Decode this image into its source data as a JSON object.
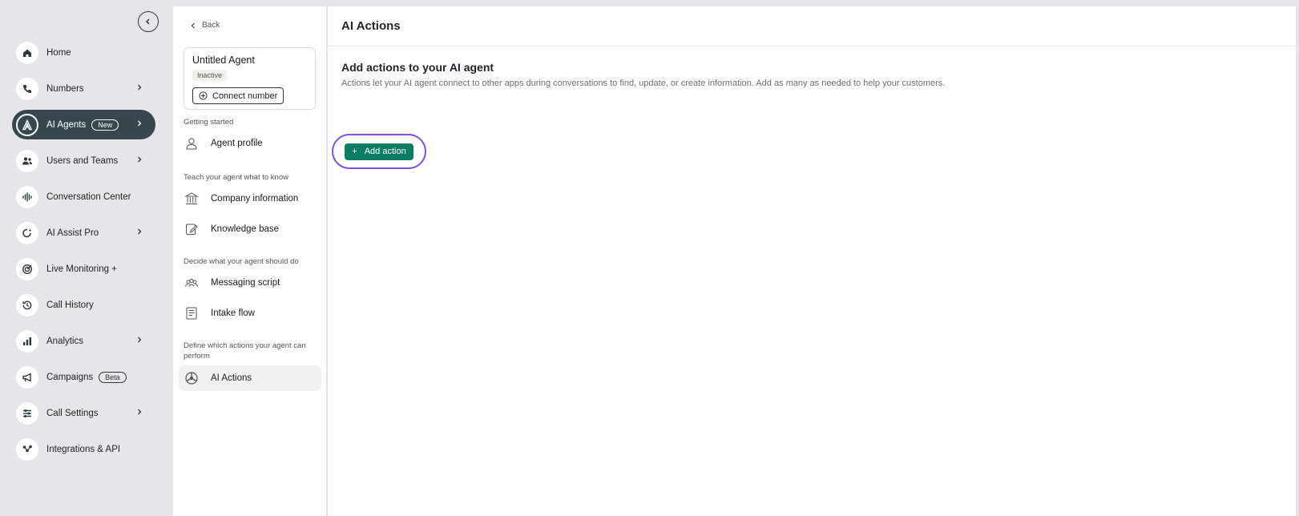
{
  "sidebar": {
    "collapse_label": "‹",
    "items": [
      {
        "label": "Home",
        "icon": "home-icon",
        "chevron": false,
        "badge": ""
      },
      {
        "label": "Numbers",
        "icon": "phone-icon",
        "chevron": true,
        "badge": ""
      },
      {
        "label": "AI Agents",
        "icon": "ai-agent-icon",
        "chevron": true,
        "badge": "New",
        "active": true
      },
      {
        "label": "Users and Teams",
        "icon": "users-icon",
        "chevron": true,
        "badge": ""
      },
      {
        "label": "Conversation Center",
        "icon": "waveform-icon",
        "chevron": false,
        "badge": ""
      },
      {
        "label": "AI Assist Pro",
        "icon": "ai-assist-icon",
        "chevron": true,
        "badge": ""
      },
      {
        "label": "Live Monitoring +",
        "icon": "radar-icon",
        "chevron": false,
        "badge": ""
      },
      {
        "label": "Call History",
        "icon": "history-icon",
        "chevron": false,
        "badge": ""
      },
      {
        "label": "Analytics",
        "icon": "bar-chart-icon",
        "chevron": true,
        "badge": ""
      },
      {
        "label": "Campaigns",
        "icon": "megaphone-icon",
        "chevron": false,
        "badge": "Beta"
      },
      {
        "label": "Call Settings",
        "icon": "sliders-icon",
        "chevron": true,
        "badge": ""
      },
      {
        "label": "Integrations & API",
        "icon": "integrations-icon",
        "chevron": false,
        "badge": ""
      }
    ]
  },
  "agent_panel": {
    "back_label": "Back",
    "agent_name": "Untitled Agent",
    "status": "Inactive",
    "connect_label": "Connect number",
    "sections": {
      "getting_started": "Getting started",
      "teach": "Teach your agent what to know",
      "decide": "Decide what your agent should do",
      "define": "Define which actions your agent can perform"
    },
    "menu": {
      "agent_profile": "Agent profile",
      "company_information": "Company information",
      "knowledge_base": "Knowledge base",
      "messaging_script": "Messaging script",
      "intake_flow": "Intake flow",
      "ai_actions": "AI Actions"
    }
  },
  "main": {
    "title": "AI Actions",
    "heading": "Add actions to your AI agent",
    "description": "Actions let your AI agent connect to other apps during conversations to find, update, or create information. Add as many as needed to help your customers.",
    "add_action_label": "Add action",
    "add_action_icon": "+"
  },
  "colors": {
    "nav_active": "#37474d",
    "primary_button": "#0b7d65",
    "highlight_ring": "#7b4fe0"
  }
}
